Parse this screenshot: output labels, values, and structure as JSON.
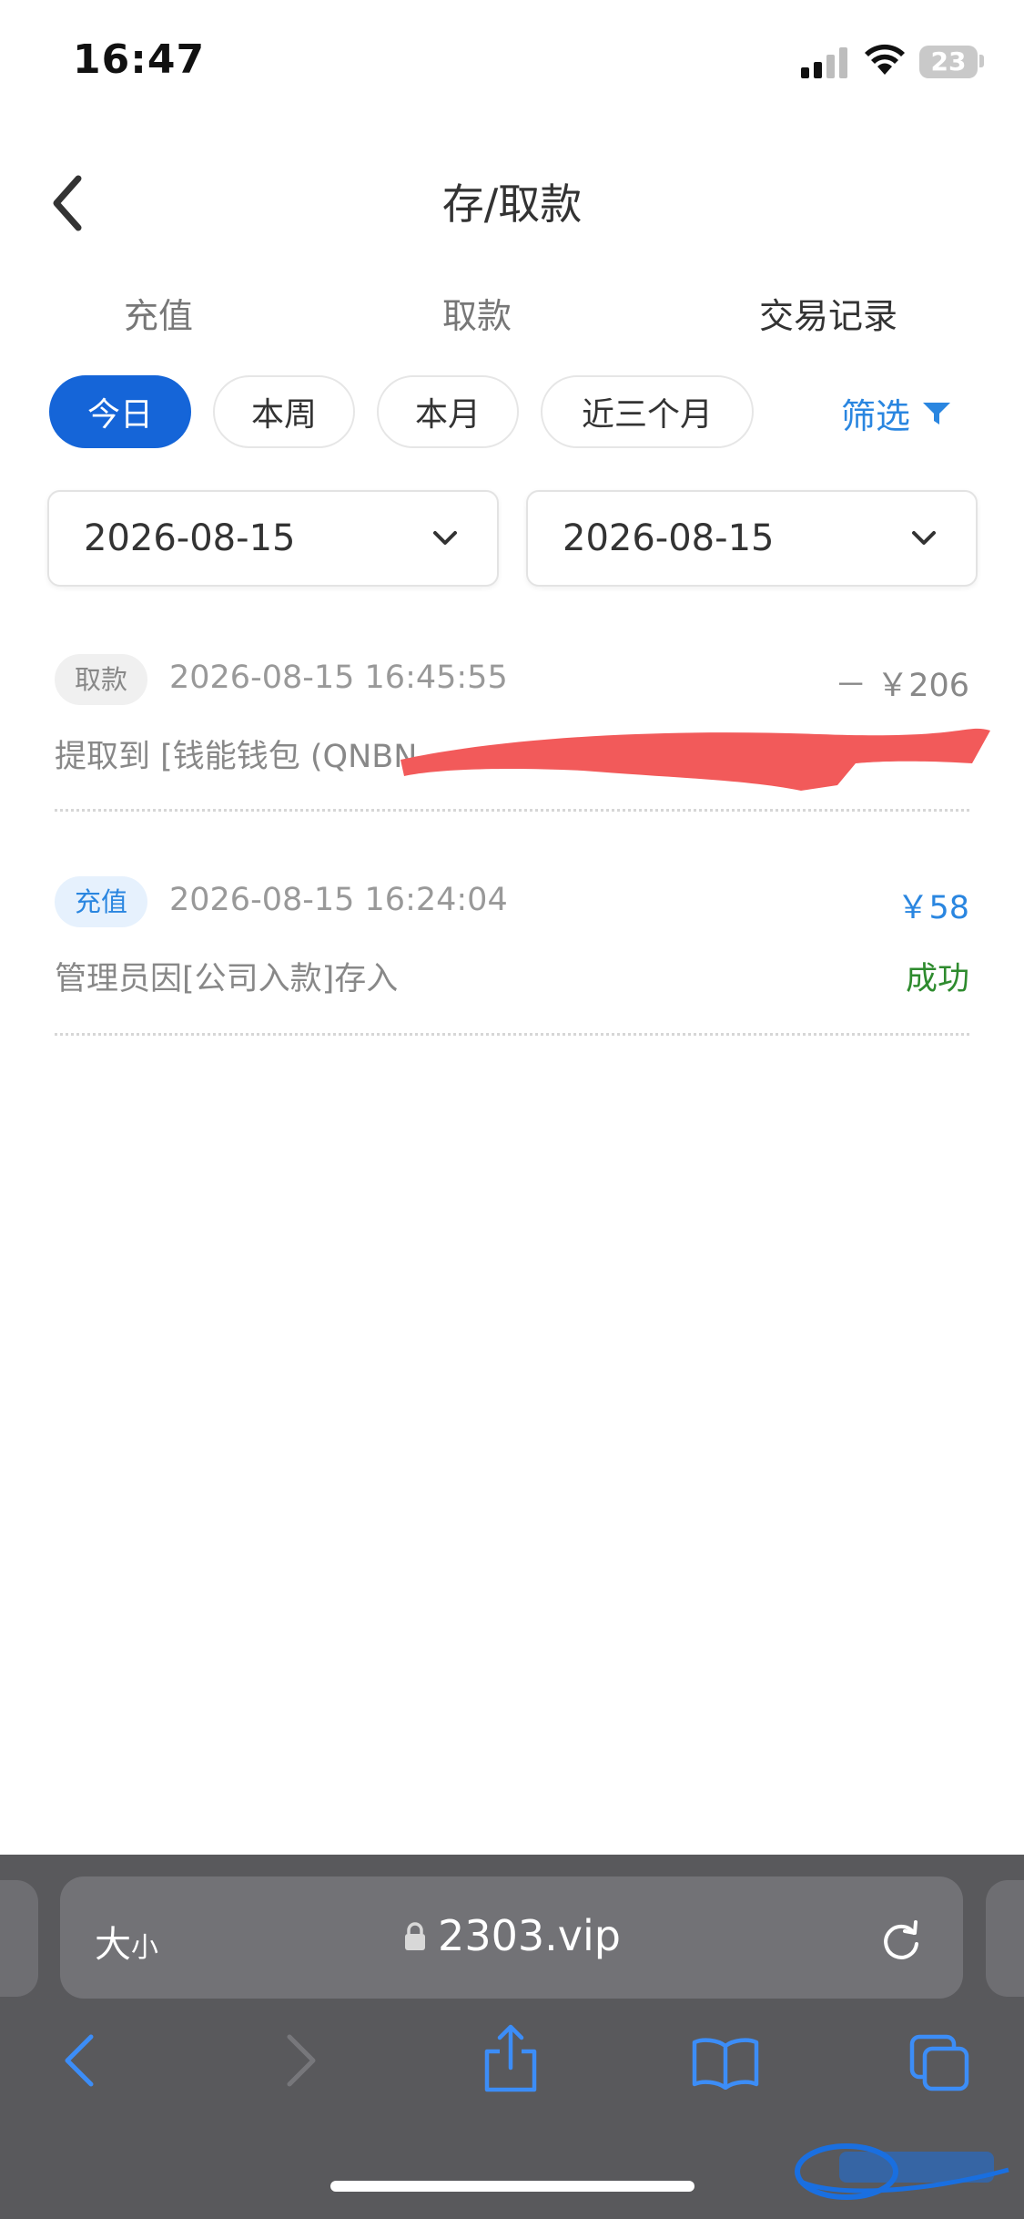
{
  "status_bar": {
    "time": "16:47",
    "battery": "23"
  },
  "header": {
    "title": "存/取款"
  },
  "tabs": [
    {
      "label": "充值"
    },
    {
      "label": "取款"
    },
    {
      "label": "交易记录"
    }
  ],
  "period_filters": [
    {
      "label": "今日"
    },
    {
      "label": "本周"
    },
    {
      "label": "本月"
    },
    {
      "label": "近三个月"
    }
  ],
  "filter_label": "筛选",
  "date_range": {
    "start": "2026-08-15",
    "end": "2026-08-15"
  },
  "records": [
    {
      "type": "取款",
      "time": "2026-08-15 16:45:55",
      "amount": "－ ￥206",
      "description": "提取到 [钱能钱包 (QNBN",
      "status": ""
    },
    {
      "type": "充值",
      "time": "2026-08-15 16:24:04",
      "amount": "￥58",
      "description": "管理员因[公司入款]存入",
      "status": "成功"
    }
  ],
  "browser": {
    "aa_large": "大",
    "aa_small": "小",
    "url": "2303.vip"
  },
  "colors": {
    "accent": "#1565d8",
    "link": "#2a86e0",
    "success": "#2e8b2e",
    "redaction": "#f25a5a"
  }
}
